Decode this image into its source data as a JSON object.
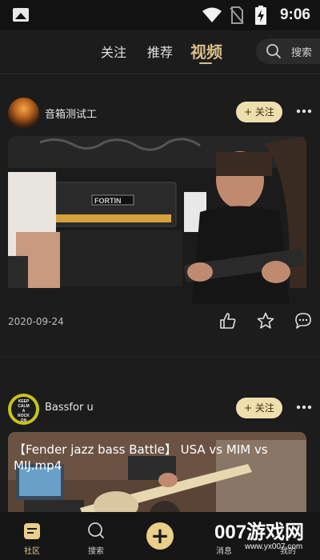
{
  "status_bar": {
    "time": "9:06"
  },
  "top_nav": {
    "tabs": [
      {
        "label": "关注"
      },
      {
        "label": "推荐"
      },
      {
        "label": "视频",
        "active": true
      }
    ],
    "search_label": "搜索",
    "accent_color": "#d8c08a"
  },
  "posts": [
    {
      "username": "音箱测试工",
      "follow_label": "+ 关注",
      "thumbnail_text": "FORTIN",
      "date": "2020-09-24"
    },
    {
      "username": "Bassfor u",
      "avatar_text": [
        "KEEP",
        "CALM",
        "A",
        "ROCK",
        "ON"
      ],
      "follow_label": "+ 关注",
      "caption": "【Fender jazz bass Battle】 USA vs MIM vs MIJ.mp4"
    }
  ],
  "bottom_nav": {
    "items": [
      {
        "label": "社区",
        "active": true
      },
      {
        "label": "搜索"
      },
      {
        "label": ""
      },
      {
        "label": "消息"
      },
      {
        "label": "我的"
      }
    ]
  },
  "watermark": {
    "text": "007游戏网",
    "url": "www.yx007.com"
  }
}
